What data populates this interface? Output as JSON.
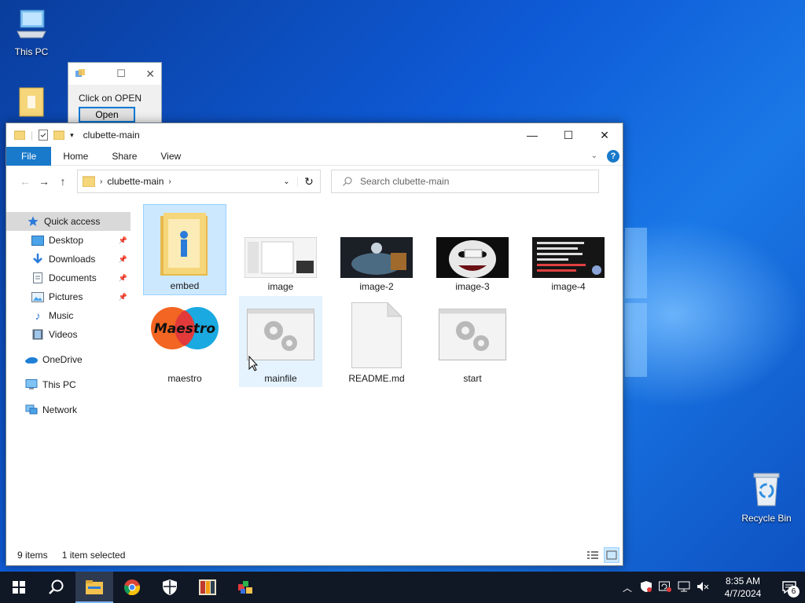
{
  "desktop": {
    "icons": [
      {
        "label": "This PC"
      },
      {
        "label": ""
      },
      {
        "label": "Recycle Bin"
      }
    ]
  },
  "dialog": {
    "message": "Click on OPEN",
    "button": "Open"
  },
  "explorer": {
    "title": "clubette-main",
    "ribbon_tabs": [
      "File",
      "Home",
      "Share",
      "View"
    ],
    "breadcrumb": "clubette-main",
    "search_placeholder": "Search clubette-main",
    "nav": [
      {
        "label": "Quick access",
        "icon": "star-icon",
        "selected": true
      },
      {
        "label": "Desktop",
        "icon": "desktop-icon",
        "pinned": true
      },
      {
        "label": "Downloads",
        "icon": "downloads-icon",
        "pinned": true
      },
      {
        "label": "Documents",
        "icon": "documents-icon",
        "pinned": true
      },
      {
        "label": "Pictures",
        "icon": "pictures-icon",
        "pinned": true
      },
      {
        "label": "Music",
        "icon": "music-icon"
      },
      {
        "label": "Videos",
        "icon": "videos-icon"
      },
      {
        "label": "OneDrive",
        "icon": "cloud-icon"
      },
      {
        "label": "This PC",
        "icon": "computer-icon"
      },
      {
        "label": "Network",
        "icon": "network-icon"
      }
    ],
    "files": [
      {
        "name": "embed",
        "type": "folder",
        "state": "selected"
      },
      {
        "name": "image",
        "type": "image-thumb"
      },
      {
        "name": "image-2",
        "type": "image-thumb"
      },
      {
        "name": "image-3",
        "type": "image-thumb"
      },
      {
        "name": "image-4",
        "type": "image-thumb"
      },
      {
        "name": "maestro",
        "type": "logo"
      },
      {
        "name": "mainfile",
        "type": "exe",
        "state": "hover"
      },
      {
        "name": "README.md",
        "type": "doc"
      },
      {
        "name": "start",
        "type": "exe"
      }
    ],
    "status": {
      "items": "9 items",
      "selected": "1 item selected"
    }
  },
  "taskbar": {
    "time": "8:35 AM",
    "date": "4/7/2024",
    "notifications": "6"
  },
  "colors": {
    "accent": "#1979ca",
    "taskbar": "#101826",
    "selection": "#cce8ff"
  }
}
